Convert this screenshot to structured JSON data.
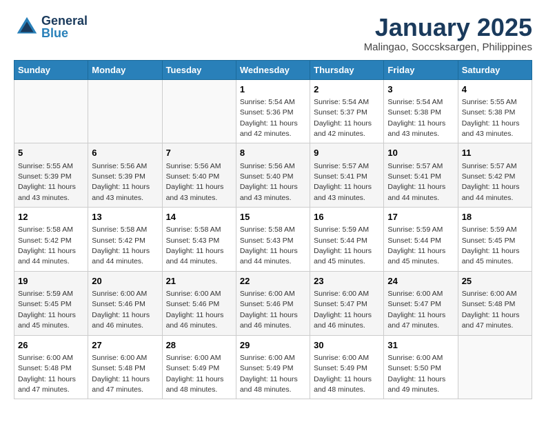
{
  "header": {
    "logo_general": "General",
    "logo_blue": "Blue",
    "title": "January 2025",
    "subtitle": "Malingao, Soccsksargen, Philippines"
  },
  "days_of_week": [
    "Sunday",
    "Monday",
    "Tuesday",
    "Wednesday",
    "Thursday",
    "Friday",
    "Saturday"
  ],
  "weeks": [
    [
      {
        "day": "",
        "info": ""
      },
      {
        "day": "",
        "info": ""
      },
      {
        "day": "",
        "info": ""
      },
      {
        "day": "1",
        "info": "Sunrise: 5:54 AM\nSunset: 5:36 PM\nDaylight: 11 hours\nand 42 minutes."
      },
      {
        "day": "2",
        "info": "Sunrise: 5:54 AM\nSunset: 5:37 PM\nDaylight: 11 hours\nand 42 minutes."
      },
      {
        "day": "3",
        "info": "Sunrise: 5:54 AM\nSunset: 5:38 PM\nDaylight: 11 hours\nand 43 minutes."
      },
      {
        "day": "4",
        "info": "Sunrise: 5:55 AM\nSunset: 5:38 PM\nDaylight: 11 hours\nand 43 minutes."
      }
    ],
    [
      {
        "day": "5",
        "info": "Sunrise: 5:55 AM\nSunset: 5:39 PM\nDaylight: 11 hours\nand 43 minutes."
      },
      {
        "day": "6",
        "info": "Sunrise: 5:56 AM\nSunset: 5:39 PM\nDaylight: 11 hours\nand 43 minutes."
      },
      {
        "day": "7",
        "info": "Sunrise: 5:56 AM\nSunset: 5:40 PM\nDaylight: 11 hours\nand 43 minutes."
      },
      {
        "day": "8",
        "info": "Sunrise: 5:56 AM\nSunset: 5:40 PM\nDaylight: 11 hours\nand 43 minutes."
      },
      {
        "day": "9",
        "info": "Sunrise: 5:57 AM\nSunset: 5:41 PM\nDaylight: 11 hours\nand 43 minutes."
      },
      {
        "day": "10",
        "info": "Sunrise: 5:57 AM\nSunset: 5:41 PM\nDaylight: 11 hours\nand 44 minutes."
      },
      {
        "day": "11",
        "info": "Sunrise: 5:57 AM\nSunset: 5:42 PM\nDaylight: 11 hours\nand 44 minutes."
      }
    ],
    [
      {
        "day": "12",
        "info": "Sunrise: 5:58 AM\nSunset: 5:42 PM\nDaylight: 11 hours\nand 44 minutes."
      },
      {
        "day": "13",
        "info": "Sunrise: 5:58 AM\nSunset: 5:42 PM\nDaylight: 11 hours\nand 44 minutes."
      },
      {
        "day": "14",
        "info": "Sunrise: 5:58 AM\nSunset: 5:43 PM\nDaylight: 11 hours\nand 44 minutes."
      },
      {
        "day": "15",
        "info": "Sunrise: 5:58 AM\nSunset: 5:43 PM\nDaylight: 11 hours\nand 44 minutes."
      },
      {
        "day": "16",
        "info": "Sunrise: 5:59 AM\nSunset: 5:44 PM\nDaylight: 11 hours\nand 45 minutes."
      },
      {
        "day": "17",
        "info": "Sunrise: 5:59 AM\nSunset: 5:44 PM\nDaylight: 11 hours\nand 45 minutes."
      },
      {
        "day": "18",
        "info": "Sunrise: 5:59 AM\nSunset: 5:45 PM\nDaylight: 11 hours\nand 45 minutes."
      }
    ],
    [
      {
        "day": "19",
        "info": "Sunrise: 5:59 AM\nSunset: 5:45 PM\nDaylight: 11 hours\nand 45 minutes."
      },
      {
        "day": "20",
        "info": "Sunrise: 6:00 AM\nSunset: 5:46 PM\nDaylight: 11 hours\nand 46 minutes."
      },
      {
        "day": "21",
        "info": "Sunrise: 6:00 AM\nSunset: 5:46 PM\nDaylight: 11 hours\nand 46 minutes."
      },
      {
        "day": "22",
        "info": "Sunrise: 6:00 AM\nSunset: 5:46 PM\nDaylight: 11 hours\nand 46 minutes."
      },
      {
        "day": "23",
        "info": "Sunrise: 6:00 AM\nSunset: 5:47 PM\nDaylight: 11 hours\nand 46 minutes."
      },
      {
        "day": "24",
        "info": "Sunrise: 6:00 AM\nSunset: 5:47 PM\nDaylight: 11 hours\nand 47 minutes."
      },
      {
        "day": "25",
        "info": "Sunrise: 6:00 AM\nSunset: 5:48 PM\nDaylight: 11 hours\nand 47 minutes."
      }
    ],
    [
      {
        "day": "26",
        "info": "Sunrise: 6:00 AM\nSunset: 5:48 PM\nDaylight: 11 hours\nand 47 minutes."
      },
      {
        "day": "27",
        "info": "Sunrise: 6:00 AM\nSunset: 5:48 PM\nDaylight: 11 hours\nand 47 minutes."
      },
      {
        "day": "28",
        "info": "Sunrise: 6:00 AM\nSunset: 5:49 PM\nDaylight: 11 hours\nand 48 minutes."
      },
      {
        "day": "29",
        "info": "Sunrise: 6:00 AM\nSunset: 5:49 PM\nDaylight: 11 hours\nand 48 minutes."
      },
      {
        "day": "30",
        "info": "Sunrise: 6:00 AM\nSunset: 5:49 PM\nDaylight: 11 hours\nand 48 minutes."
      },
      {
        "day": "31",
        "info": "Sunrise: 6:00 AM\nSunset: 5:50 PM\nDaylight: 11 hours\nand 49 minutes."
      },
      {
        "day": "",
        "info": ""
      }
    ]
  ]
}
